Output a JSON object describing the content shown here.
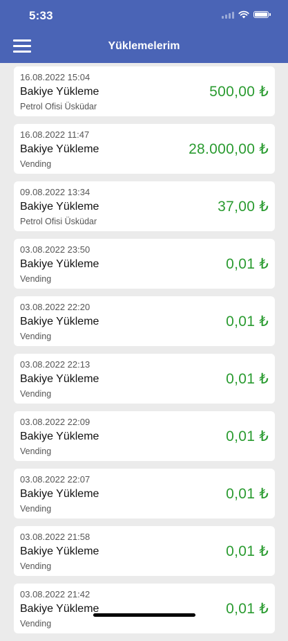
{
  "status_bar": {
    "time": "5:33"
  },
  "header": {
    "title": "Yüklemelerim"
  },
  "icons": {
    "menu": "hamburger-menu-icon",
    "wifi": "wifi-icon",
    "battery": "battery-icon",
    "signal": "signal-icon"
  },
  "colors": {
    "header_bg": "#4a64b6",
    "amount": "#2a9b30",
    "page_bg": "#ebebeb"
  },
  "transactions": [
    {
      "date": "16.08.2022 15:04",
      "type": "Bakiye Yükleme",
      "location": "Petrol Ofisi Üsküdar",
      "amount": "500,00 ₺"
    },
    {
      "date": "16.08.2022 11:47",
      "type": "Bakiye Yükleme",
      "location": "Vending",
      "amount": "28.000,00 ₺"
    },
    {
      "date": "09.08.2022 13:34",
      "type": "Bakiye Yükleme",
      "location": "Petrol Ofisi Üsküdar",
      "amount": "37,00 ₺"
    },
    {
      "date": "03.08.2022 23:50",
      "type": "Bakiye Yükleme",
      "location": "Vending",
      "amount": "0,01 ₺"
    },
    {
      "date": "03.08.2022 22:20",
      "type": "Bakiye Yükleme",
      "location": "Vending",
      "amount": "0,01 ₺"
    },
    {
      "date": "03.08.2022 22:13",
      "type": "Bakiye Yükleme",
      "location": "Vending",
      "amount": "0,01 ₺"
    },
    {
      "date": "03.08.2022 22:09",
      "type": "Bakiye Yükleme",
      "location": "Vending",
      "amount": "0,01 ₺"
    },
    {
      "date": "03.08.2022 22:07",
      "type": "Bakiye Yükleme",
      "location": "Vending",
      "amount": "0,01 ₺"
    },
    {
      "date": "03.08.2022 21:58",
      "type": "Bakiye Yükleme",
      "location": "Vending",
      "amount": "0,01 ₺"
    },
    {
      "date": "03.08.2022 21:42",
      "type": "Bakiye Yükleme",
      "location": "Vending",
      "amount": "0,01 ₺"
    }
  ]
}
